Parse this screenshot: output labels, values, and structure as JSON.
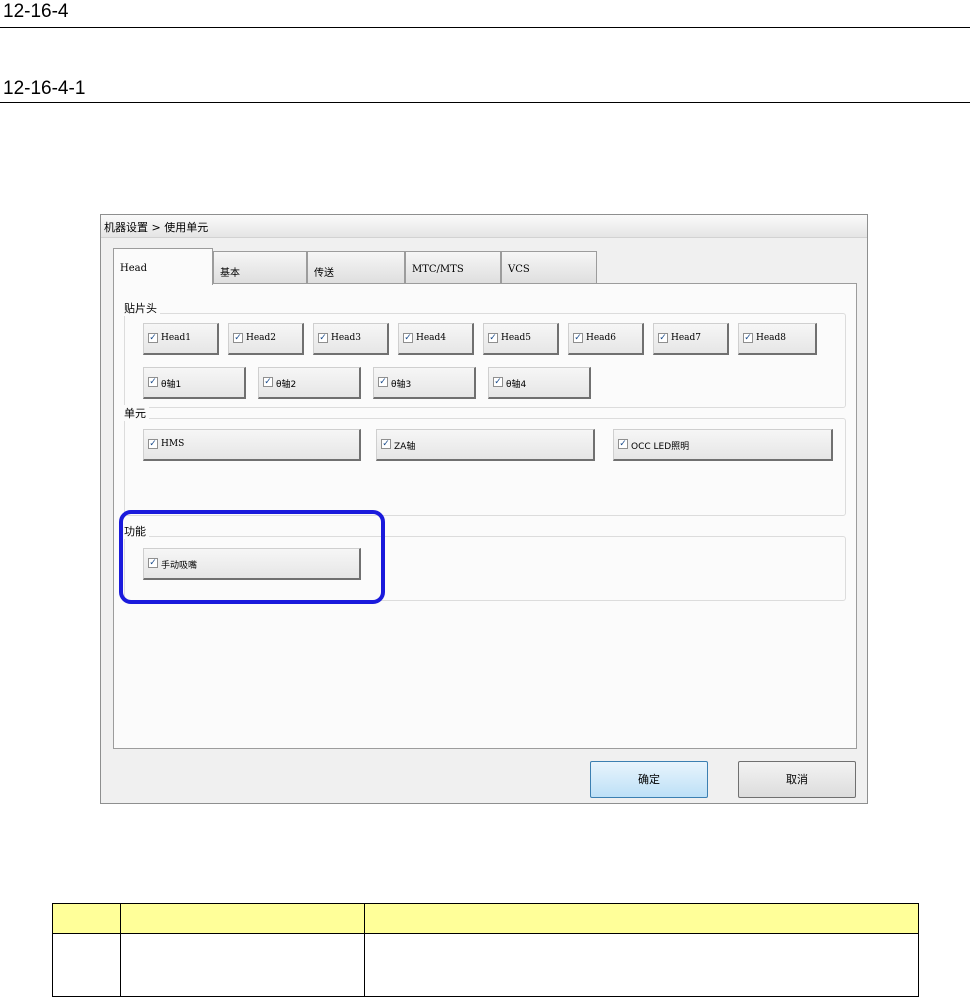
{
  "sections": {
    "heading1": "12-16-4",
    "heading2": "12-16-4-1"
  },
  "window": {
    "title": "机器设置 > 使用单元"
  },
  "tabs": [
    "Head",
    "基本",
    "传送",
    "MTC/MTS",
    "VCS"
  ],
  "groups": {
    "head": {
      "label": "贴片头",
      "heads": [
        "Head1",
        "Head2",
        "Head3",
        "Head4",
        "Head5",
        "Head6",
        "Head7",
        "Head8"
      ],
      "axes": [
        "θ轴1",
        "θ轴2",
        "θ轴3",
        "θ轴4"
      ]
    },
    "unit": {
      "label": "单元",
      "items": [
        "HMS",
        "ZA轴",
        "OCC LED照明"
      ]
    },
    "function": {
      "label": "功能",
      "items": [
        "手动吸嘴"
      ]
    }
  },
  "checkbox_mark": "✓",
  "buttons": {
    "ok": "确定",
    "cancel": "取消"
  },
  "table": {
    "header": [
      "",
      "",
      ""
    ],
    "rows": [
      [
        "",
        "",
        ""
      ]
    ]
  },
  "colors": {
    "highlight": "#1a1adc",
    "table_header": "#ffff99"
  }
}
